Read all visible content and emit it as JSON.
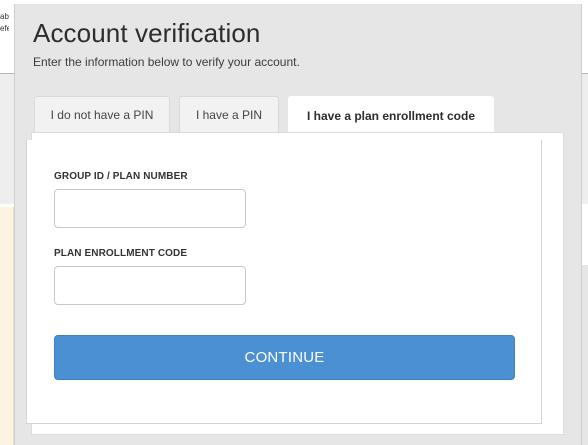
{
  "background": {
    "text_line_1": "abo",
    "text_line_2": "efer"
  },
  "modal": {
    "title": "Account verification",
    "subtitle": "Enter the information below to verify your account."
  },
  "tabs": [
    {
      "label": "I do not have a PIN",
      "active": false
    },
    {
      "label": "I have a PIN",
      "active": false
    },
    {
      "label": "I have a plan enrollment code",
      "active": true
    }
  ],
  "form": {
    "group_id_label": "GROUP ID / PLAN NUMBER",
    "group_id_value": "",
    "enrollment_code_label": "PLAN ENROLLMENT CODE",
    "enrollment_code_value": "",
    "continue_label": "CONTINUE"
  },
  "colors": {
    "accent": "#4a90d2",
    "modal_background": "#e6e6e6"
  }
}
